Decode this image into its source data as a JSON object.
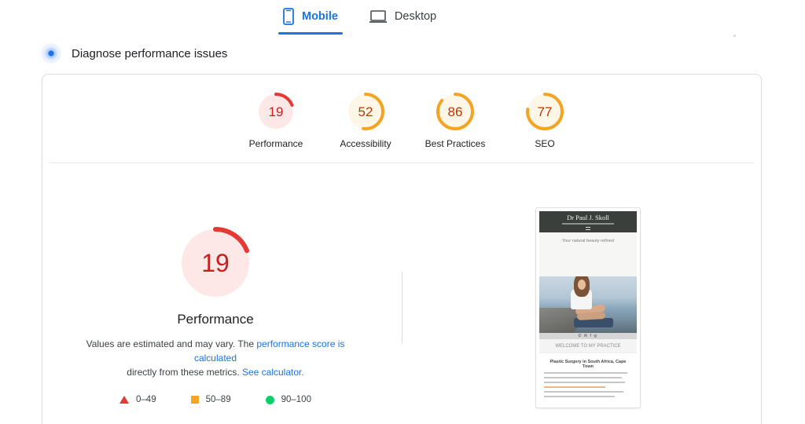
{
  "tabs": [
    {
      "label": "Mobile",
      "icon": "mobile-icon",
      "active": true
    },
    {
      "label": "Desktop",
      "icon": "desktop-icon",
      "active": false
    }
  ],
  "diagnose": {
    "title": "Diagnose performance issues",
    "icon": "lab-data-icon"
  },
  "scores": [
    {
      "label": "Performance",
      "value": 19,
      "color": "#e53935",
      "track": "#fde7e7",
      "text_color": "#c5221f"
    },
    {
      "label": "Accessibility",
      "value": 52,
      "color": "#f4a423",
      "track": "#fef6e7",
      "text_color": "#c33300"
    },
    {
      "label": "Best Practices",
      "value": 86,
      "color": "#f4a423",
      "track": "#fef6e7",
      "text_color": "#c33300"
    },
    {
      "label": "SEO",
      "value": 77,
      "color": "#f4a423",
      "track": "#fef6e7",
      "text_color": "#c33300"
    }
  ],
  "main_score": {
    "label": "Performance",
    "value": 19,
    "color": "#e53935",
    "track": "#fde7e7",
    "text_color": "#c5221f"
  },
  "description": {
    "text1": "Values are estimated and may vary. The ",
    "link1": "performance score is calculated",
    "text2": " directly from these metrics. ",
    "link2": "See calculator."
  },
  "legend": [
    {
      "range": "0–49",
      "shape": "triangle",
      "color": "#e53935"
    },
    {
      "range": "50–89",
      "shape": "square",
      "color": "#f4a423"
    },
    {
      "range": "90–100",
      "shape": "circle",
      "color": "#0cce6b"
    }
  ],
  "preview": {
    "site_title": "Dr Paul J. Skoll",
    "tagline": "Your natural beauty refined",
    "welcome": "WELCOME TO MY PRACTICE",
    "heading": "Plastic Surgery in South Africa, Cape Town",
    "social": "✆ ✉ f ◎"
  }
}
